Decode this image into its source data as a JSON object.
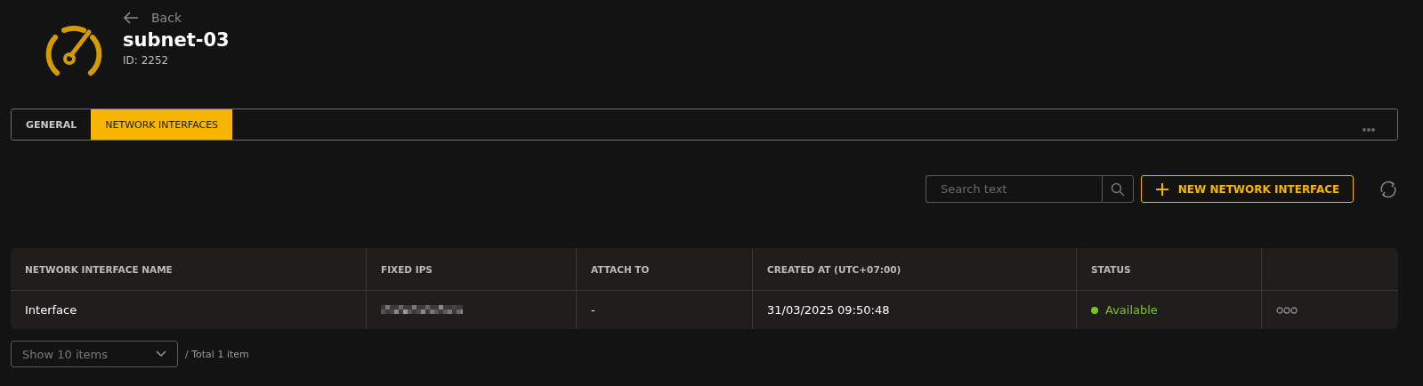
{
  "header": {
    "back": "Back",
    "title": "subnet-03",
    "id": "ID: 2252"
  },
  "tabs": [
    {
      "label": "GENERAL",
      "selected": false
    },
    {
      "label": "NETWORK INTERFACES",
      "selected": true
    }
  ],
  "toolbar": {
    "search": {
      "placeholder": "Search text"
    },
    "new_button": "NEW NETWORK INTERFACE"
  },
  "table": {
    "columns": [
      "NETWORK INTERFACE NAME",
      "FIXED IPS",
      "ATTACH TO",
      "CREATED AT (UTC+07:00)",
      "STATUS"
    ],
    "rows": [
      {
        "name": "Interface",
        "fixed_ips": {
          "kind": "redacted"
        },
        "attach_to": "-",
        "created_at": "31/03/2025 09:50:48",
        "status": {
          "label": "Available",
          "color": "#7cc417"
        }
      }
    ]
  },
  "footer": {
    "page_size": "Show 10 items",
    "total": "/ Total 1 item"
  }
}
